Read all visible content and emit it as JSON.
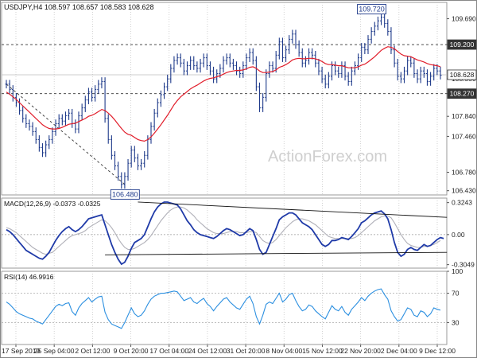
{
  "header": {
    "symbol": "USDJPY,H4",
    "ohlc": "108.597 108.657 108.583 108.628"
  },
  "watermark": "ActionForex.com",
  "colors": {
    "price": "#1e3a8a",
    "ema": "#e11d2a",
    "macd": "#1f3aa8",
    "signal": "#b0b0b8",
    "rsi": "#2b8fe0",
    "trendline": "#111111",
    "grid": "#c8c8c8",
    "current_price_label_bg": "#ffffff"
  },
  "chart_data": [
    {
      "type": "line",
      "pane": "price",
      "title": "USDJPY,H4 108.597 108.657 108.583 108.628",
      "x_labels": [
        "17 Sep 2019",
        "25 Sep 04:00",
        "2 Oct 12:00",
        "9 Oct 20:00",
        "17 Oct 04:00",
        "24 Oct 12:00",
        "31 Oct 20:00",
        "8 Nov 04:00",
        "15 Nov 12:00",
        "22 Nov 20:00",
        "2 Dec 04:00",
        "9 Dec 12:00"
      ],
      "y_ticks": [
        109.69,
        109.2,
        108.55,
        108.27,
        107.84,
        107.46,
        106.78,
        106.43
      ],
      "ylim": [
        106.35,
        110.0
      ],
      "series": [
        {
          "values": [
            108.45,
            108.35,
            108.2,
            108.1,
            107.95,
            107.8,
            107.7,
            107.65,
            107.55,
            107.4,
            107.25,
            107.15,
            107.3,
            107.4,
            107.55,
            107.7,
            107.8,
            107.75,
            107.85,
            107.9,
            107.7,
            107.6,
            107.85,
            108.0,
            108.15,
            108.3,
            108.2,
            108.35,
            108.45,
            108.5,
            107.8,
            107.4,
            107.1,
            106.9,
            106.7,
            106.55,
            106.7,
            106.95,
            107.2,
            107.05,
            106.9,
            106.95,
            107.1,
            107.4,
            107.65,
            107.9,
            108.1,
            108.25,
            108.4,
            108.55,
            108.75,
            108.9,
            108.95,
            108.85,
            108.7,
            108.8,
            108.9,
            108.8,
            108.75,
            108.85,
            108.95,
            108.8,
            108.7,
            108.55,
            108.65,
            108.75,
            108.9,
            108.95,
            108.85,
            108.8,
            108.7,
            108.65,
            108.8,
            108.95,
            109.05,
            108.9,
            108.4,
            108.0,
            108.2,
            108.65,
            108.8,
            108.75,
            109.0,
            109.25,
            108.95,
            109.1,
            109.3,
            109.4,
            109.2,
            109.05,
            108.85,
            108.9,
            109.05,
            109.0,
            108.85,
            108.7,
            108.55,
            108.45,
            108.6,
            108.8,
            108.7,
            108.65,
            108.8,
            108.6,
            108.5,
            108.7,
            108.8,
            108.95,
            109.15,
            109.1,
            109.3,
            109.45,
            109.55,
            109.65,
            109.72,
            109.6,
            109.45,
            109.1,
            108.85,
            108.6,
            108.55,
            108.7,
            108.9,
            108.85,
            108.65,
            108.55,
            108.7,
            108.65,
            108.5,
            108.6,
            108.75,
            108.7,
            108.62
          ]
        },
        {
          "values": [
            108.3,
            108.26,
            108.21,
            108.16,
            108.1,
            108.04,
            107.98,
            107.92,
            107.86,
            107.8,
            107.74,
            107.68,
            107.64,
            107.61,
            107.6,
            107.6,
            107.61,
            107.63,
            107.66,
            107.69,
            107.7,
            107.71,
            107.74,
            107.77,
            107.8,
            107.84,
            107.86,
            107.89,
            107.93,
            107.97,
            107.95,
            107.9,
            107.84,
            107.77,
            107.69,
            107.61,
            107.54,
            107.5,
            107.48,
            107.44,
            107.4,
            107.38,
            107.37,
            107.4,
            107.45,
            107.52,
            107.6,
            107.68,
            107.77,
            107.86,
            107.96,
            108.06,
            108.14,
            108.21,
            108.26,
            108.31,
            108.36,
            108.4,
            108.43,
            108.47,
            108.51,
            108.54,
            108.56,
            108.57,
            108.59,
            108.61,
            108.64,
            108.67,
            108.69,
            108.7,
            108.71,
            108.71,
            108.72,
            108.74,
            108.77,
            108.78,
            108.75,
            108.7,
            108.67,
            108.67,
            108.68,
            108.69,
            108.72,
            108.77,
            108.79,
            108.82,
            108.86,
            108.91,
            108.93,
            108.94,
            108.93,
            108.93,
            108.94,
            108.94,
            108.93,
            108.91,
            108.88,
            108.84,
            108.82,
            108.82,
            108.81,
            108.8,
            108.8,
            108.78,
            108.76,
            108.76,
            108.76,
            108.78,
            108.81,
            108.83,
            108.87,
            108.92,
            108.97,
            109.03,
            109.09,
            109.13,
            109.16,
            109.15,
            109.12,
            109.07,
            109.02,
            108.99,
            108.98,
            108.97,
            108.94,
            108.91,
            108.89,
            108.87,
            108.84,
            108.82,
            108.81,
            108.8,
            108.78
          ]
        }
      ],
      "horizontal_levels": [
        109.2,
        108.27
      ],
      "current_price": 108.628,
      "level_labels": [
        "109.200",
        "108.270",
        "108.628"
      ],
      "annotations": [
        {
          "text": "109.720",
          "x_index": 114,
          "y": 109.72
        },
        {
          "text": "106.480",
          "x_index": 39,
          "y": 106.48
        }
      ],
      "trend_line_from": {
        "x_index": 0,
        "y": 108.45
      },
      "trend_line_to": {
        "x_index": 36,
        "y": 106.55
      },
      "grid": true
    },
    {
      "type": "line",
      "pane": "macd",
      "title": "MACD(12,26,9) -0.0373 -0.0325",
      "y_ticks": [
        0.3243,
        0.0,
        -0.3049
      ],
      "y_tick_labels": [
        "0.3243",
        "0.00",
        "-0.3049"
      ],
      "ylim": [
        -0.34,
        0.37
      ],
      "series": [
        {
          "values": [
            0.05,
            0.03,
            0.0,
            -0.04,
            -0.08,
            -0.12,
            -0.16,
            -0.18,
            -0.2,
            -0.22,
            -0.24,
            -0.25,
            -0.22,
            -0.18,
            -0.12,
            -0.06,
            -0.01,
            0.03,
            0.06,
            0.08,
            0.05,
            0.03,
            0.05,
            0.08,
            0.12,
            0.16,
            0.17,
            0.18,
            0.19,
            0.2,
            0.1,
            0.0,
            -0.1,
            -0.18,
            -0.25,
            -0.3,
            -0.28,
            -0.22,
            -0.14,
            -0.08,
            -0.06,
            -0.04,
            0.0,
            0.08,
            0.16,
            0.23,
            0.28,
            0.31,
            0.33,
            0.33,
            0.32,
            0.31,
            0.3,
            0.26,
            0.2,
            0.14,
            0.1,
            0.05,
            0.02,
            0.0,
            -0.01,
            -0.02,
            -0.03,
            -0.04,
            -0.02,
            0.01,
            0.04,
            0.06,
            0.05,
            0.03,
            0.01,
            -0.01,
            0.0,
            0.03,
            0.06,
            0.04,
            -0.05,
            -0.15,
            -0.2,
            -0.18,
            -0.1,
            -0.02,
            0.06,
            0.15,
            0.18,
            0.2,
            0.22,
            0.22,
            0.2,
            0.16,
            0.12,
            0.1,
            0.08,
            0.05,
            0.0,
            -0.05,
            -0.1,
            -0.12,
            -0.1,
            -0.06,
            -0.06,
            -0.05,
            -0.03,
            -0.04,
            -0.05,
            -0.02,
            0.02,
            0.06,
            0.12,
            0.14,
            0.17,
            0.2,
            0.22,
            0.23,
            0.24,
            0.21,
            0.16,
            0.05,
            -0.08,
            -0.18,
            -0.22,
            -0.2,
            -0.15,
            -0.13,
            -0.15,
            -0.16,
            -0.13,
            -0.1,
            -0.12,
            -0.11,
            -0.08,
            -0.05,
            -0.03,
            -0.04
          ]
        },
        {
          "values": [
            0.07,
            0.06,
            0.04,
            0.02,
            -0.01,
            -0.04,
            -0.07,
            -0.1,
            -0.13,
            -0.15,
            -0.17,
            -0.19,
            -0.2,
            -0.19,
            -0.18,
            -0.15,
            -0.12,
            -0.09,
            -0.06,
            -0.03,
            -0.01,
            0.0,
            0.01,
            0.02,
            0.04,
            0.07,
            0.09,
            0.11,
            0.13,
            0.15,
            0.14,
            0.11,
            0.07,
            0.02,
            -0.04,
            -0.09,
            -0.13,
            -0.15,
            -0.15,
            -0.14,
            -0.12,
            -0.1,
            -0.08,
            -0.05,
            -0.01,
            0.04,
            0.09,
            0.14,
            0.18,
            0.22,
            0.25,
            0.27,
            0.28,
            0.28,
            0.27,
            0.25,
            0.22,
            0.19,
            0.15,
            0.12,
            0.09,
            0.06,
            0.04,
            0.02,
            0.01,
            0.01,
            0.01,
            0.02,
            0.03,
            0.03,
            0.03,
            0.02,
            0.02,
            0.02,
            0.03,
            0.03,
            0.02,
            -0.02,
            -0.06,
            -0.08,
            -0.09,
            -0.08,
            -0.05,
            -0.01,
            0.03,
            0.07,
            0.1,
            0.13,
            0.15,
            0.16,
            0.16,
            0.15,
            0.14,
            0.12,
            0.1,
            0.07,
            0.04,
            0.01,
            -0.02,
            -0.03,
            -0.04,
            -0.04,
            -0.04,
            -0.04,
            -0.04,
            -0.04,
            -0.03,
            -0.01,
            0.02,
            0.05,
            0.08,
            0.11,
            0.14,
            0.16,
            0.18,
            0.19,
            0.19,
            0.17,
            0.12,
            0.06,
            0.0,
            -0.05,
            -0.09,
            -0.11,
            -0.12,
            -0.13,
            -0.13,
            -0.12,
            -0.12,
            -0.11,
            -0.1,
            -0.08,
            -0.06
          ]
        }
      ],
      "trend_lines": [
        {
          "from": {
            "x_index": 40,
            "y": 0.33
          },
          "to": {
            "x_index": 134,
            "y": 0.175
          }
        },
        {
          "from": {
            "x_index": 30,
            "y": -0.205
          },
          "to": {
            "x_index": 134,
            "y": -0.18
          }
        }
      ],
      "grid": true
    },
    {
      "type": "line",
      "pane": "rsi",
      "title": "RSI(14) 46.9916",
      "y_ticks": [
        100,
        70,
        30,
        0
      ],
      "ylim": [
        0,
        100
      ],
      "series": [
        {
          "values": [
            58,
            55,
            50,
            45,
            42,
            40,
            38,
            36,
            35,
            32,
            30,
            28,
            34,
            40,
            46,
            52,
            55,
            53,
            56,
            57,
            45,
            40,
            50,
            56,
            60,
            64,
            58,
            62,
            65,
            66,
            44,
            34,
            28,
            26,
            24,
            22,
            30,
            40,
            50,
            42,
            38,
            40,
            46,
            55,
            62,
            66,
            68,
            70,
            70,
            71,
            72,
            73,
            72,
            66,
            60,
            62,
            64,
            58,
            56,
            60,
            63,
            56,
            52,
            46,
            52,
            57,
            62,
            64,
            58,
            54,
            50,
            48,
            55,
            62,
            66,
            56,
            38,
            28,
            40,
            55,
            58,
            56,
            63,
            70,
            58,
            62,
            68,
            70,
            60,
            52,
            46,
            48,
            54,
            52,
            46,
            42,
            38,
            35,
            44,
            53,
            48,
            46,
            52,
            44,
            40,
            48,
            53,
            58,
            64,
            60,
            66,
            70,
            73,
            75,
            76,
            68,
            62,
            46,
            38,
            32,
            34,
            42,
            50,
            48,
            40,
            38,
            46,
            44,
            38,
            42,
            50,
            48,
            46.99
          ]
        }
      ],
      "grid": true
    }
  ]
}
